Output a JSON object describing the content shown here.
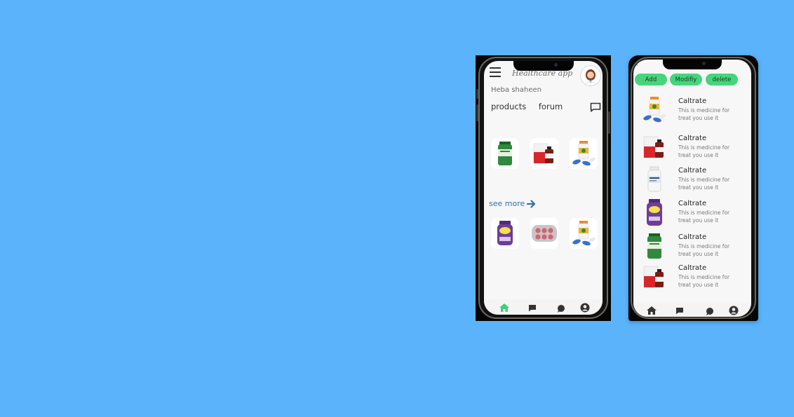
{
  "left_screen": {
    "app_title": "Healthcare app",
    "user_name": "Heba shaheen",
    "tabs": [
      "products",
      "forum"
    ],
    "see_more": "see more"
  },
  "right_screen": {
    "actions": {
      "add": "Add",
      "modify": "Modifiy",
      "delete": "delete"
    },
    "items": [
      {
        "name": "Caltrate",
        "desc1": "This is medicine for",
        "desc2": "treat you use it",
        "thumb": "pill-bottles"
      },
      {
        "name": "Caltrate",
        "desc1": "This is medicine for",
        "desc2": "treat you use it",
        "thumb": "red-box-bottle"
      },
      {
        "name": "Caltrate",
        "desc1": "This is medicine for",
        "desc2": "treat you use it",
        "thumb": "white-bottle"
      },
      {
        "name": "Caltrate",
        "desc1": "This is medicine for",
        "desc2": "treat you use it",
        "thumb": "purple-bottle"
      },
      {
        "name": "Caltrate",
        "desc1": "This is medicine for",
        "desc2": "treat you use it",
        "thumb": "green-bottle"
      },
      {
        "name": "Caltrate",
        "desc1": "This is medicine for",
        "desc2": "treat you use it",
        "thumb": "red-box-bottle"
      }
    ]
  },
  "colors": {
    "background": "#5ab3fb",
    "accent_green": "#46d57c",
    "link_blue": "#2f6fb0",
    "active_nav": "#3ed17a"
  },
  "icons": [
    "menu-icon",
    "chat-icon",
    "arrow-right-icon",
    "home-icon",
    "message-icon",
    "comment-icon",
    "account-icon",
    "back-icon"
  ]
}
